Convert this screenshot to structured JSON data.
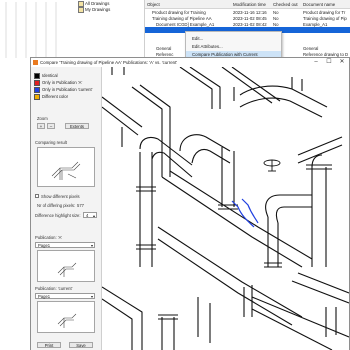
{
  "tree": {
    "items": [
      {
        "label": "All Drawings"
      },
      {
        "label": "My Drawings"
      }
    ]
  },
  "object_list": {
    "columns": [
      "Object",
      "Modification time",
      "Checked out",
      "Document name"
    ],
    "rows": [
      {
        "object": "Product drawing for Training",
        "time": "2023-11-16 12:16",
        "checked": "No",
        "doc": "Product drawing for Tr"
      },
      {
        "object": "Training drawing of Pipeline AA",
        "time": "2023-11-02 08:45",
        "checked": "No",
        "doc": "Training drawing of Pip"
      },
      {
        "object": "Document ICGD] Example_A1",
        "time": "2023-11-02 08:42",
        "checked": "No",
        "doc": "Example_A1"
      },
      {
        "object": "",
        "time": "",
        "checked": "",
        "doc": ""
      },
      {
        "object": "",
        "time": "",
        "checked": "",
        "doc": ""
      },
      {
        "object": "General",
        "time": "",
        "checked": "",
        "doc": "General"
      },
      {
        "object": "Referenc",
        "time": "",
        "checked": "",
        "doc": "Reference drawing to D"
      }
    ]
  },
  "context_menu": {
    "items": [
      {
        "label": "Edit..."
      },
      {
        "label": "Edit Attributes..."
      },
      {
        "label": "Compare Publication with Current"
      }
    ]
  },
  "compare_window": {
    "title": "Compare 'Training drawing of Pipeline AA' Publications: 'A' vs. 'current'",
    "minimize": "–",
    "maximize": "☐",
    "close": "✕",
    "legend": [
      {
        "label": "Identical",
        "color": "#000000"
      },
      {
        "label": "Only in Publication 'A'",
        "color": "#e02020"
      },
      {
        "label": "Only in Publication 'current'",
        "color": "#2040e0"
      },
      {
        "label": "Different color",
        "color": "#f0b000"
      }
    ],
    "zoom_label": "Zoom",
    "zoom_in": "+",
    "zoom_out": "–",
    "extents_button": "Extents",
    "comparing_result_label": "Comparing result",
    "show_different_pixels_label": "Show different pixels",
    "diff_pixels_label": "Nr of differing pixels:",
    "diff_pixels_value": "577",
    "highlight_size_label": "Difference highlight size:",
    "highlight_size_value": "4",
    "publication_a_label": "Publication: 'A'",
    "publication_a_value": "Page1",
    "publication_current_label": "Publication: 'current'",
    "publication_current_value": "Page1",
    "print_button": "Print",
    "save_button": "Save"
  }
}
